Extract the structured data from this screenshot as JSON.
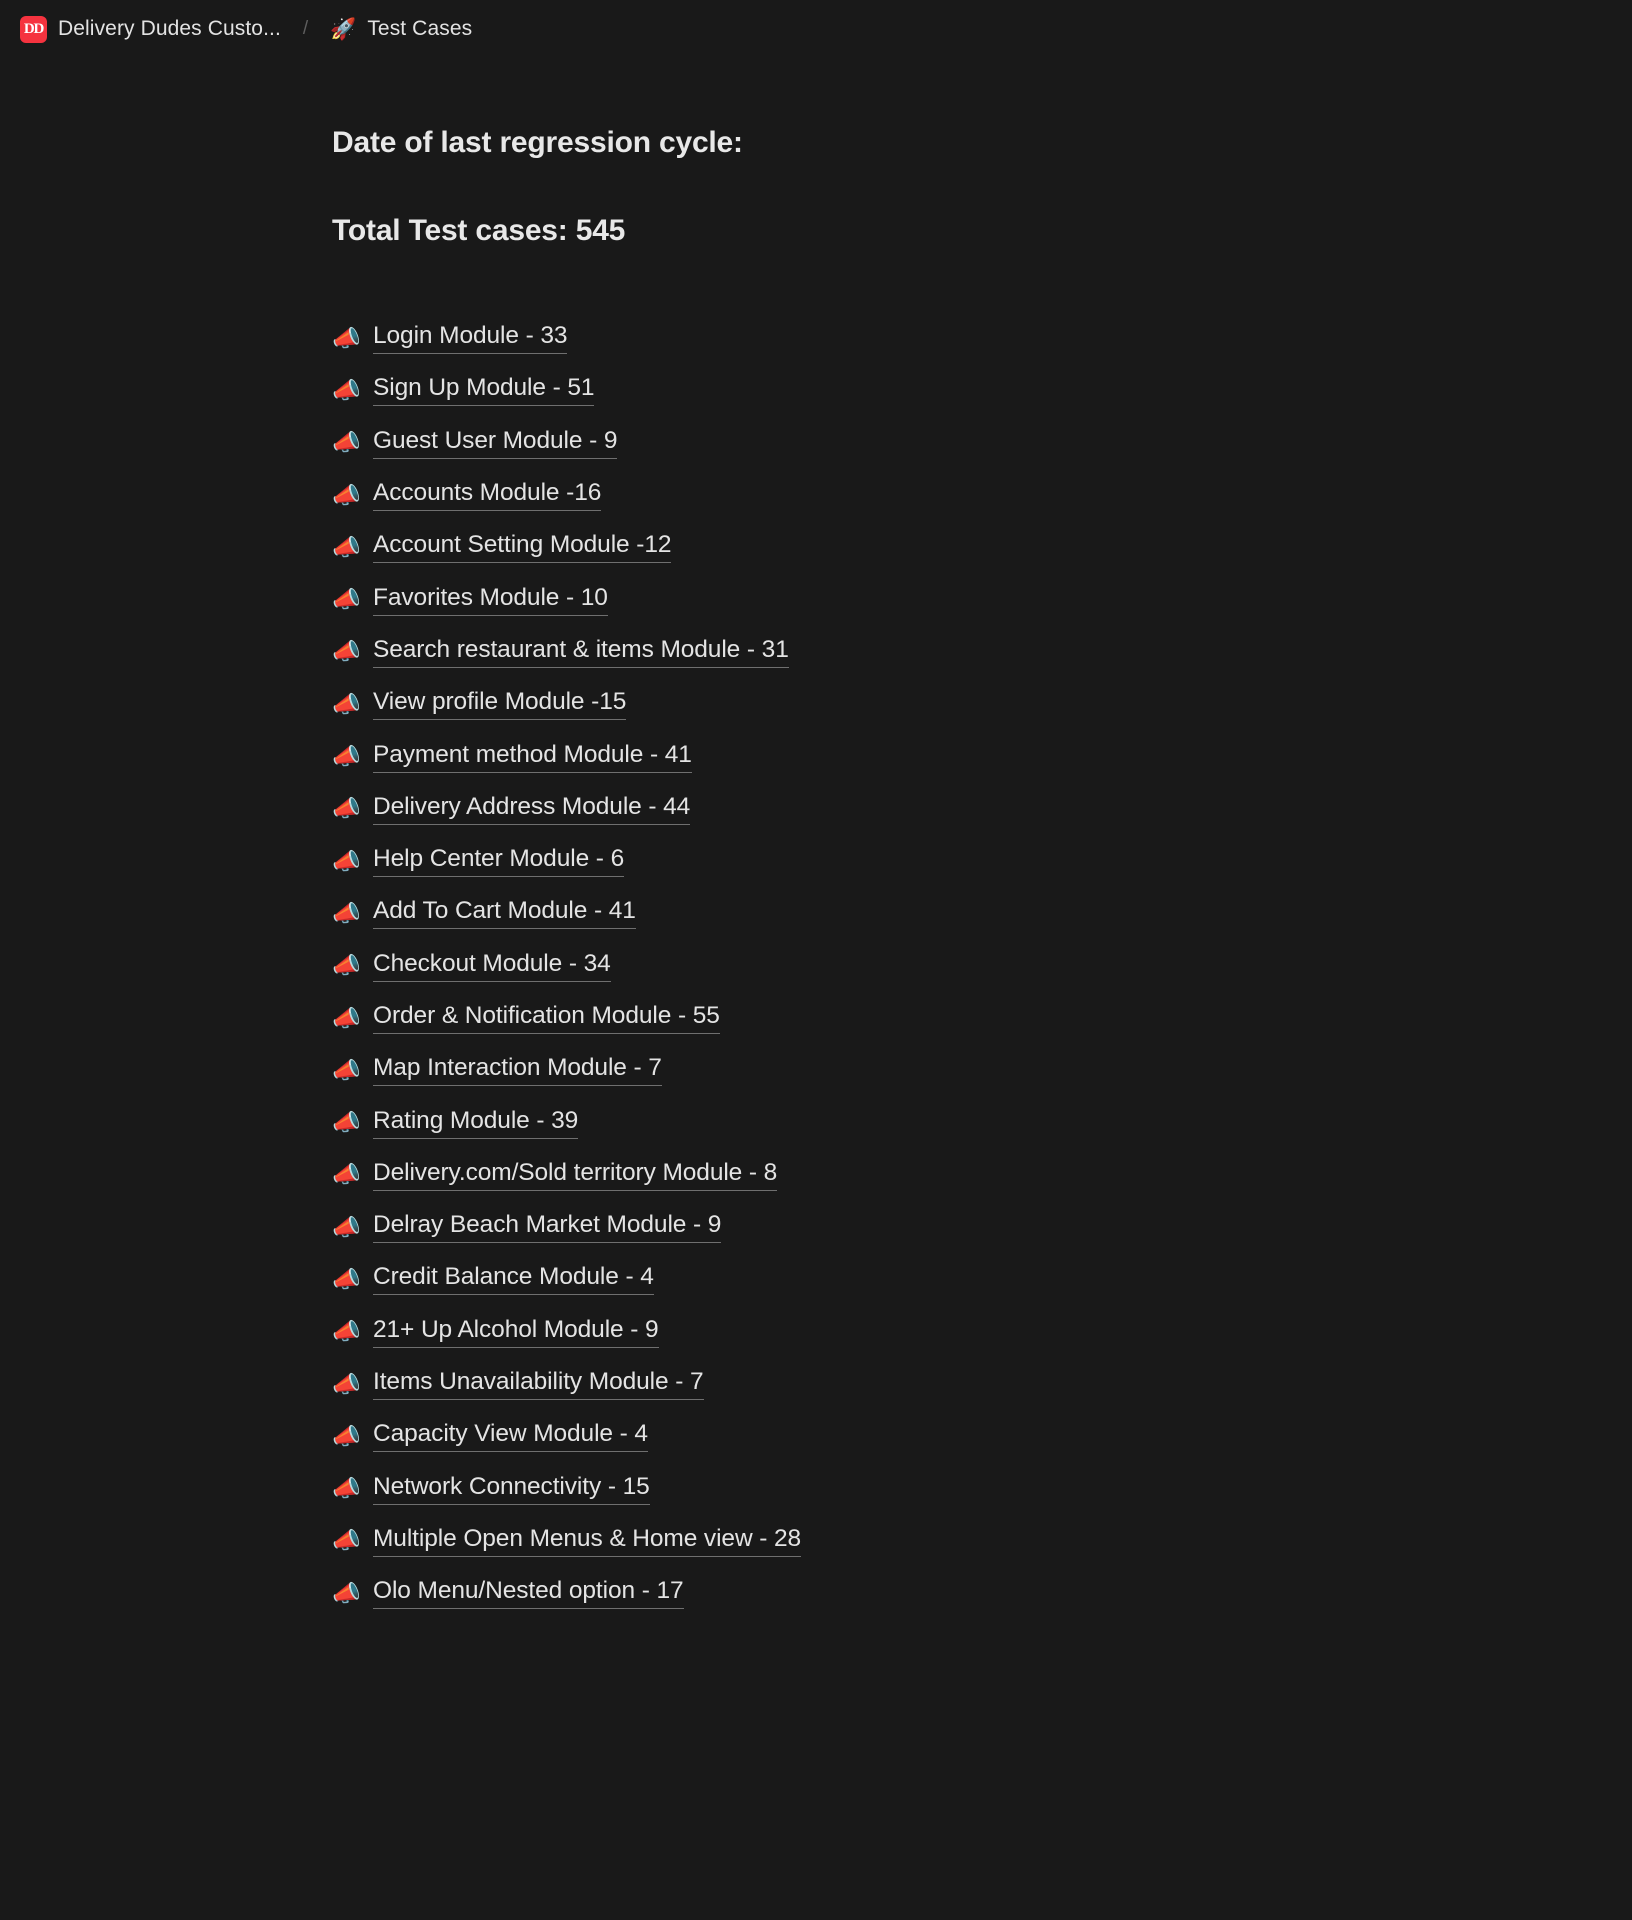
{
  "breadcrumb": {
    "workspace_logo_text": "DD",
    "workspace_logo_color": "#f5333f",
    "workspace_name": "Delivery Dudes Custo...",
    "separator": "/",
    "page_icon": "🚀",
    "page_name": "Test Cases"
  },
  "content": {
    "heading_date": "Date of last regression cycle:",
    "heading_total": "Total Test cases: 545",
    "bullet_icon": "📣",
    "modules": [
      {
        "label": "Login Module - 33"
      },
      {
        "label": "Sign Up Module - 51"
      },
      {
        "label": "Guest User Module - 9"
      },
      {
        "label": "Accounts Module -16"
      },
      {
        "label": "Account Setting Module -12"
      },
      {
        "label": "Favorites Module - 10"
      },
      {
        "label": "Search restaurant & items Module - 31"
      },
      {
        "label": "View profile Module -15"
      },
      {
        "label": "Payment method Module - 41"
      },
      {
        "label": "Delivery Address Module - 44"
      },
      {
        "label": "Help Center Module - 6"
      },
      {
        "label": "Add To Cart Module - 41"
      },
      {
        "label": "Checkout Module - 34"
      },
      {
        "label": "Order & Notification Module - 55"
      },
      {
        "label": "Map Interaction Module - 7"
      },
      {
        "label": "Rating Module - 39"
      },
      {
        "label": "Delivery.com/Sold territory Module - 8"
      },
      {
        "label": "Delray Beach Market Module - 9"
      },
      {
        "label": "Credit Balance Module - 4"
      },
      {
        "label": "21+ Up Alcohol Module - 9"
      },
      {
        "label": "Items Unavailability Module - 7"
      },
      {
        "label": "Capacity View Module - 4"
      },
      {
        "label": "Network Connectivity - 15"
      },
      {
        "label": "Multiple Open Menus & Home view - 28"
      },
      {
        "label": "Olo Menu/Nested option - 17"
      }
    ]
  }
}
